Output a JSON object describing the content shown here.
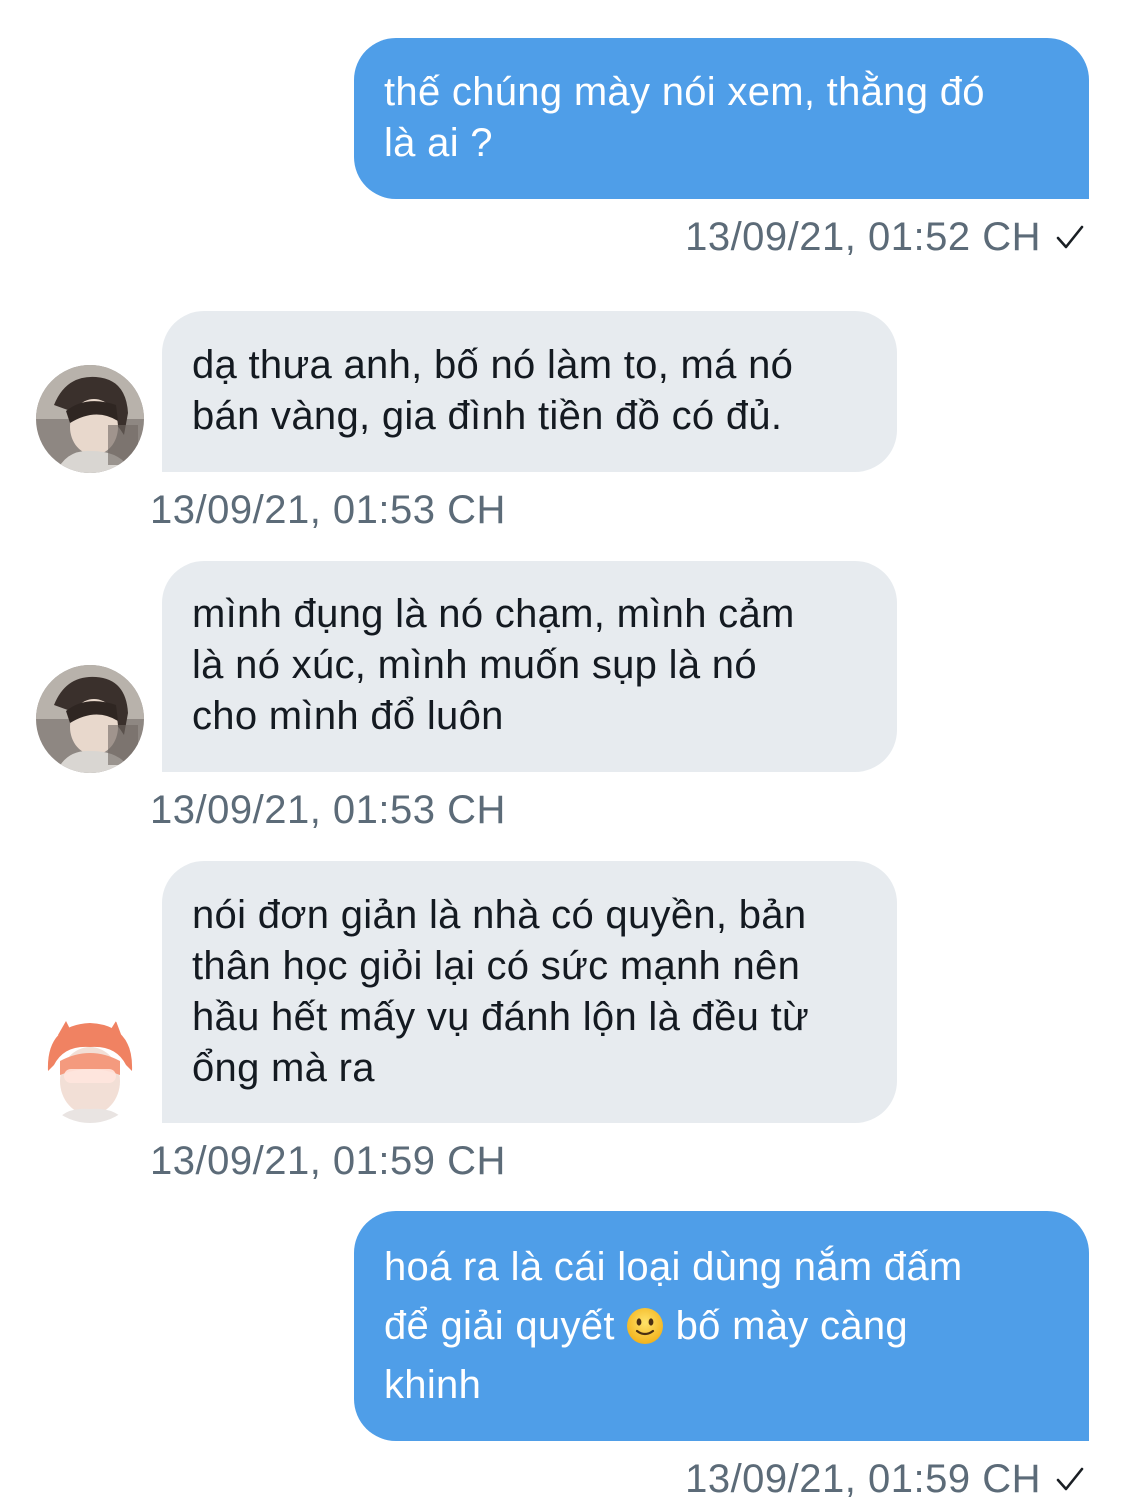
{
  "messages": [
    {
      "direction": "outgoing",
      "lines": [
        "thế chúng mày nói xem, thằng đó",
        "là ai ?"
      ],
      "timestamp": "13/09/21, 01:52 CH",
      "read_receipt": "check-icon"
    },
    {
      "direction": "incoming",
      "avatar": "avatar-dark-hair",
      "lines": [
        "dạ thưa anh, bố nó làm to, má nó",
        "bán vàng, gia đình tiền đồ có đủ."
      ],
      "timestamp": "13/09/21, 01:53 CH"
    },
    {
      "direction": "incoming",
      "avatar": "avatar-dark-hair",
      "lines": [
        "mình đụng là nó chạm, mình cảm",
        "là nó xúc, mình muốn sụp là nó",
        "cho mình đổ luôn"
      ],
      "timestamp": "13/09/21, 01:53 CH"
    },
    {
      "direction": "incoming",
      "avatar": "avatar-orange-hair",
      "lines": [
        "nói đơn giản là nhà có quyền, bản",
        "thân học giỏi lại có sức mạnh nên",
        "hầu hết mấy vụ đánh lộn là đều từ",
        "ổng mà ra"
      ],
      "timestamp": "13/09/21, 01:59 CH"
    },
    {
      "direction": "outgoing",
      "lines": [
        "hoá ra là cái loại dùng nắm đấm",
        "để giải quyết",
        "bố mày càng",
        "khinh"
      ],
      "emoji": "slightly-smiling-face-icon",
      "timestamp": "13/09/21, 01:59 CH",
      "read_receipt": "check-icon"
    }
  ],
  "colors": {
    "outgoing_bubble": "#4f9ee8",
    "incoming_bubble": "#e7ebef",
    "timestamp": "#5c6b78"
  }
}
